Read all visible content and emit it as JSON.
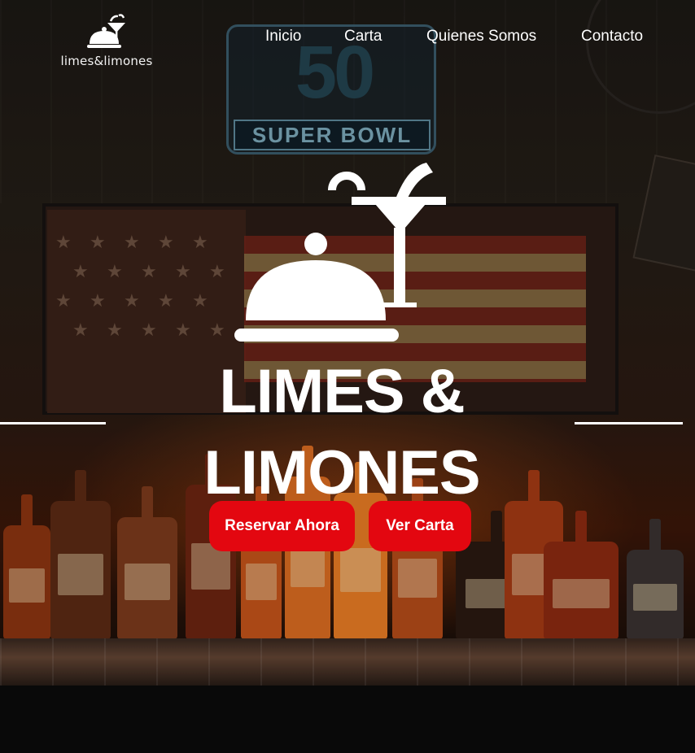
{
  "header": {
    "logo_text": "limes&limones",
    "nav": [
      {
        "label": "Inicio"
      },
      {
        "label": "Carta"
      },
      {
        "label": "Quienes Somos"
      },
      {
        "label": "Contacto"
      }
    ]
  },
  "background": {
    "sign_number": "50",
    "sign_text": "SUPER BOWL"
  },
  "hero": {
    "title_line1": "LIMES &",
    "title_line2": "LIMONES",
    "buttons": {
      "reservar_label": "Reservar Ahora",
      "vercarta_label": "Ver Carta"
    }
  },
  "colors": {
    "accent": "#e30710",
    "text": "#ffffff",
    "background": "#0b0b0b"
  },
  "icons": [
    "cloche-cocktail-logo-icon"
  ]
}
